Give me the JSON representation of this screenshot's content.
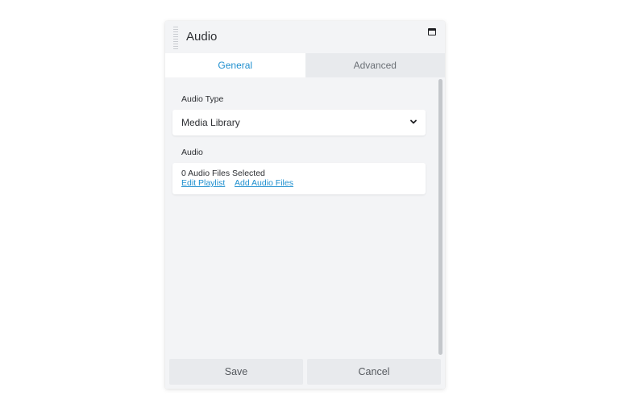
{
  "dialog": {
    "title": "Audio"
  },
  "tabs": [
    {
      "label": "General",
      "active": true
    },
    {
      "label": "Advanced",
      "active": false
    }
  ],
  "form": {
    "audio_type_label": "Audio Type",
    "audio_type_value": "Media Library",
    "audio_label": "Audio",
    "files_selected_text": "0 Audio Files Selected",
    "edit_playlist_link": "Edit Playlist",
    "add_audio_files_link": "Add Audio Files"
  },
  "footer": {
    "save_label": "Save",
    "cancel_label": "Cancel"
  },
  "colors": {
    "accent": "#1f8fcf",
    "panel_bg": "#f3f4f6",
    "button_bg": "#e8eaed"
  }
}
